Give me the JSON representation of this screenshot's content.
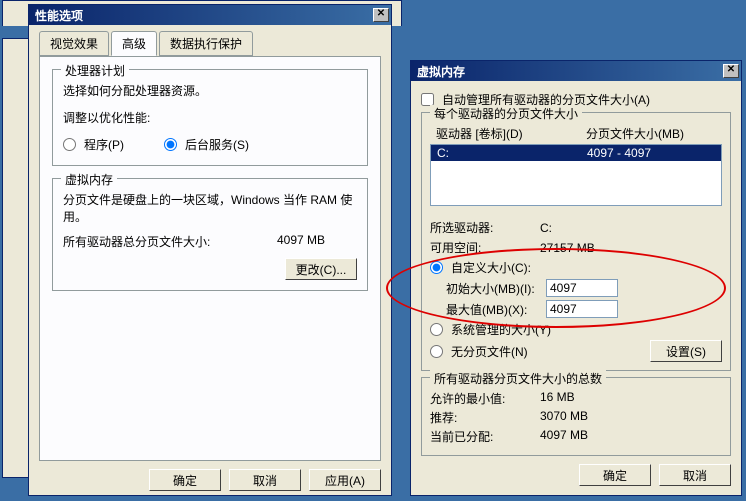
{
  "perf": {
    "title": "性能选项",
    "tabs": {
      "visual": "视觉效果",
      "advanced": "高级",
      "dep": "数据执行保护"
    },
    "scheduling": {
      "group": "处理器计划",
      "desc": "选择如何分配处理器资源。",
      "adjust": "调整以优化性能:",
      "programs": "程序(P)",
      "services": "后台服务(S)"
    },
    "vm": {
      "group": "虚拟内存",
      "desc": "分页文件是硬盘上的一块区域，Windows 当作 RAM 使用。",
      "total_label": "所有驱动器总分页文件大小:",
      "total_value": "4097 MB",
      "change": "更改(C)..."
    },
    "buttons": {
      "ok": "确定",
      "cancel": "取消",
      "apply": "应用(A)"
    }
  },
  "vmdlg": {
    "title": "虚拟内存",
    "auto_manage": "自动管理所有驱动器的分页文件大小(A)",
    "perdrive": {
      "group": "每个驱动器的分页文件大小",
      "col1": "驱动器 [卷标](D)",
      "col2": "分页文件大小(MB)",
      "rows": [
        {
          "drive": "C:",
          "size": "4097 - 4097"
        }
      ]
    },
    "selected_drive_label": "所选驱动器:",
    "selected_drive": "C:",
    "free_space_label": "可用空间:",
    "free_space": "27157 MB",
    "custom": "自定义大小(C):",
    "initial_label": "初始大小(MB)(I):",
    "initial_value": "4097",
    "max_label": "最大值(MB)(X):",
    "max_value": "4097",
    "system_managed": "系统管理的大小(Y)",
    "no_paging": "无分页文件(N)",
    "set": "设置(S)",
    "totals": {
      "group": "所有驱动器分页文件大小的总数",
      "min_label": "允许的最小值:",
      "min_value": "16 MB",
      "rec_label": "推荐:",
      "rec_value": "3070 MB",
      "cur_label": "当前已分配:",
      "cur_value": "4097 MB"
    },
    "ok": "确定",
    "cancel": "取消"
  }
}
